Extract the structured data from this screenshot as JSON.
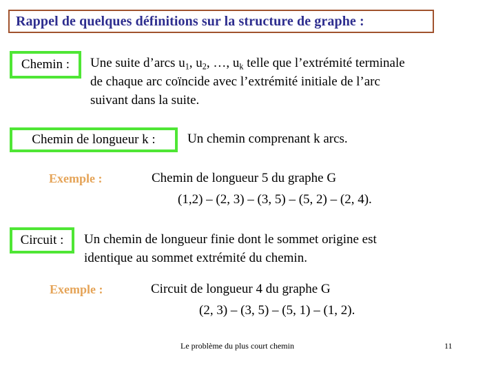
{
  "slide": {
    "title": "Rappel de quelques définitions sur la structure de graphe :",
    "title_border_color": "#A0522D",
    "title_text_color": "#2E2E8F",
    "box_border_color": "#4FE635",
    "example_label_color": "#E5A458"
  },
  "definitions": [
    {
      "term": "Chemin :",
      "body_part1": "Une suite d’arcs u",
      "sub1": "1",
      "body_part2": ", u",
      "sub2": "2",
      "body_part3": ", …, u",
      "sub3": "k",
      "body_part4": " telle que l’extrémité terminale",
      "line2": "de chaque arc coïncide avec l’extrémité initiale de l’arc",
      "line3": "suivant dans la suite."
    },
    {
      "term": "Chemin de longueur k :",
      "body": "Un chemin comprenant k arcs."
    },
    {
      "term": "Circuit :",
      "line1": "Un chemin de longueur finie dont le sommet origine est",
      "line2": "identique au sommet extrémité du chemin."
    }
  ],
  "examples": [
    {
      "label": "Exemple :",
      "line1": "Chemin de longueur 5 du graphe G",
      "line2": "(1,2) – (2, 3) – (3, 5) – (5, 2) – (2, 4)."
    },
    {
      "label": "Exemple :",
      "line1": "Circuit de longueur 4 du graphe G",
      "line2": "(2, 3) – (3, 5) – (5, 1) – (1, 2)."
    }
  ],
  "footer": {
    "text": "Le problème du plus court chemin",
    "page_number": "11"
  }
}
